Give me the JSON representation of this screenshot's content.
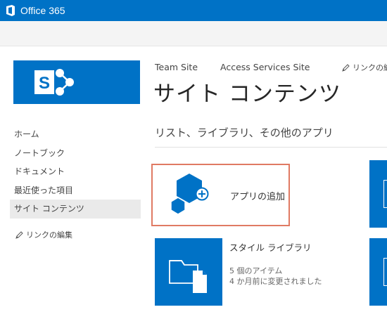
{
  "suite_bar": {
    "brand": "Office 365"
  },
  "left_nav": {
    "items": [
      {
        "label": "ホーム"
      },
      {
        "label": "ノートブック"
      },
      {
        "label": "ドキュメント"
      },
      {
        "label": "最近使った項目"
      },
      {
        "label": "サイト コンテンツ",
        "selected": true
      }
    ],
    "edit_links": "リンクの編集"
  },
  "top_nav": {
    "items": [
      {
        "label": "Team Site"
      },
      {
        "label": "Access Services Site"
      }
    ],
    "edit_links": "リンクの編"
  },
  "page": {
    "title": "サイト コンテンツ",
    "section_title": "リスト、ライブラリ、その他のアプリ"
  },
  "tiles": {
    "add_app": {
      "label": "アプリの追加"
    },
    "style_library": {
      "name": "スタイル ライブラリ",
      "item_count": "5 個のアイテム",
      "modified": "4 か月前に変更されました"
    }
  },
  "colors": {
    "brand_blue": "#0072c6",
    "highlight_border": "#e07a63"
  },
  "icons": [
    "office-logo-icon",
    "sharepoint-logo-icon",
    "pencil-icon",
    "add-app-icon",
    "folder-document-icon"
  ]
}
